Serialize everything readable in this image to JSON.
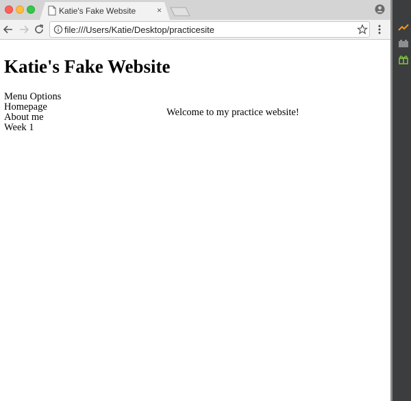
{
  "browser": {
    "tab_title": "Katie's Fake Website",
    "tab_close": "×",
    "url": "file:///Users/Katie/Desktop/practicesite"
  },
  "page": {
    "title": "Katie's Fake Website",
    "menu": {
      "heading": "Menu Options",
      "items": [
        "Homepage",
        "About me",
        "Week 1"
      ]
    },
    "welcome": "Welcome to my practice website!"
  },
  "icons": {
    "tab_page": "page-icon",
    "back": "back-arrow-icon",
    "forward": "forward-arrow-icon",
    "reload": "reload-icon",
    "info": "info-icon",
    "star": "star-icon",
    "menu": "kebab-menu-icon",
    "profile": "profile-icon"
  },
  "colors": {
    "close": "#fc605c",
    "minimize": "#fdbc40",
    "zoom": "#34c84a",
    "side_orange": "#f29b1d",
    "side_green": "#7cc242"
  }
}
